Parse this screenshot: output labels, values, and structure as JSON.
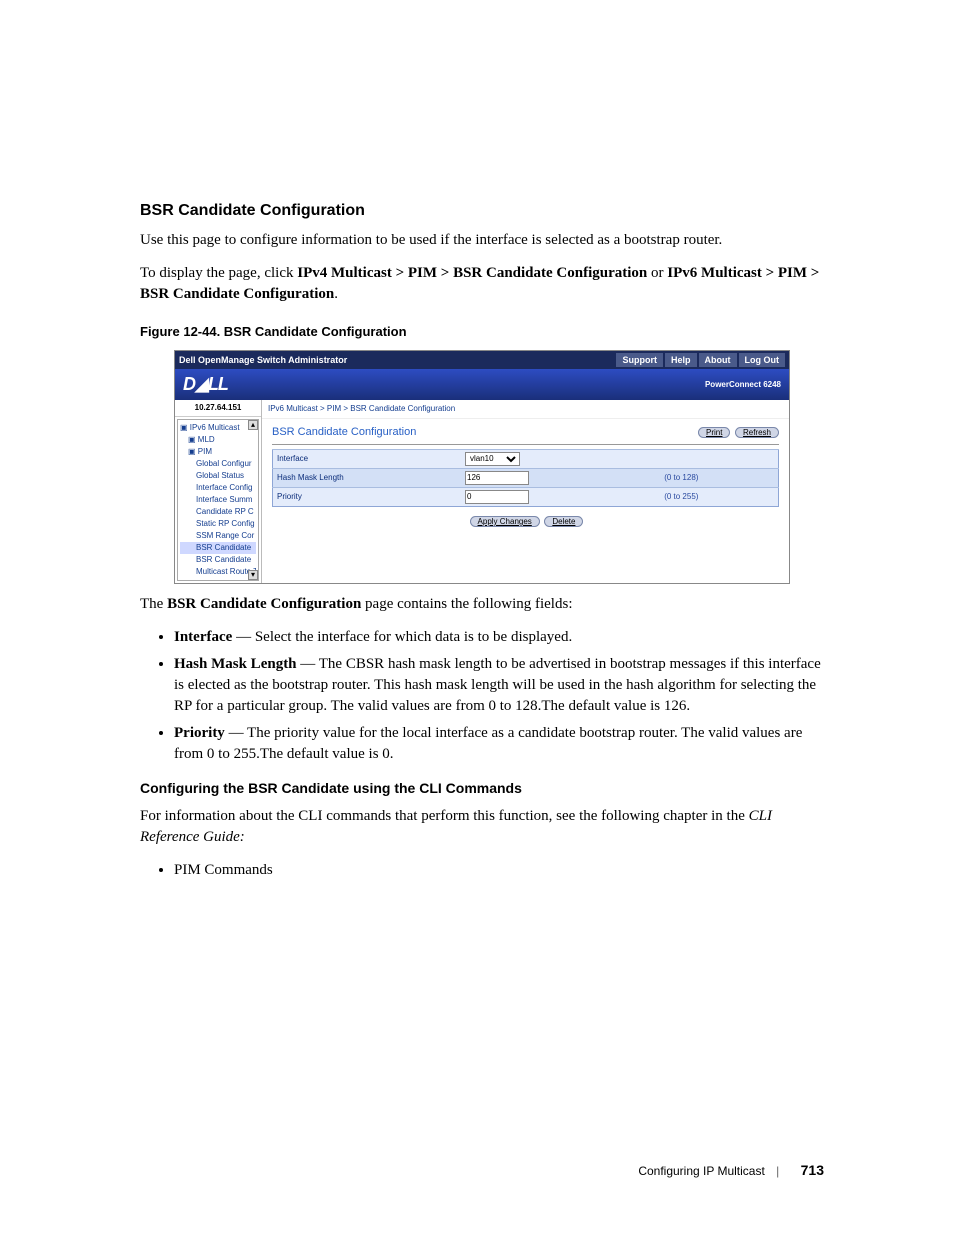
{
  "section_title": "BSR Candidate Configuration",
  "intro": "Use this page to configure information to be used if the interface is selected as a bootstrap router.",
  "nav_sentence_lead": "To display the page, click ",
  "nav_path_a": "IPv4 Multicast > PIM > BSR Candidate Configuration",
  "nav_or": " or ",
  "nav_path_b": "IPv6 Multicast > PIM > BSR Candidate Configuration",
  "nav_period": ".",
  "figure_caption": "Figure 12-44.    BSR Candidate Configuration",
  "screenshot": {
    "app_title": "Dell OpenManage Switch Administrator",
    "toplinks": [
      "Support",
      "Help",
      "About",
      "Log Out"
    ],
    "logo_text": "DELL",
    "model": "PowerConnect 6248",
    "ip": "10.27.64.151",
    "tree": {
      "root": "IPv6 Multicast",
      "mld": "MLD",
      "pim": "PIM",
      "items": [
        "Global Configur",
        "Global Status",
        "Interface Config",
        "Interface Summ",
        "Candidate RP C",
        "Static RP Config",
        "SSM Range Cor",
        "BSR Candidate",
        "BSR Candidate",
        "Multicast Route Ta"
      ],
      "selected_index": 7
    },
    "breadcrumb": "IPv6 Multicast > PIM > BSR Candidate Configuration",
    "panel_title": "BSR Candidate Configuration",
    "buttons": {
      "print": "Print",
      "refresh": "Refresh",
      "apply": "Apply Changes",
      "delete": "Delete"
    },
    "form": {
      "interface_label": "Interface",
      "interface_value": "vlan10",
      "hash_label": "Hash Mask Length",
      "hash_value": "126",
      "hash_hint": "(0 to 128)",
      "priority_label": "Priority",
      "priority_value": "0",
      "priority_hint": "(0 to 255)"
    }
  },
  "fields_intro_lead": "The ",
  "fields_intro_bold": "BSR Candidate Configuration",
  "fields_intro_tail": " page contains the following fields:",
  "bullets": [
    {
      "t": "Interface",
      "d": " — Select the interface for which data is to be displayed."
    },
    {
      "t": "Hash Mask Length",
      "d": " — The CBSR hash mask length to be advertised in bootstrap messages if this interface is elected as the bootstrap router. This hash mask length will be used in the hash algorithm for selecting the RP for a particular group. The valid values are from 0 to 128.The default value is 126."
    },
    {
      "t": "Priority",
      "d": " — The priority value for the local interface as a candidate bootstrap router. The valid values are from 0 to 255.The default value is 0."
    }
  ],
  "cli_heading": "Configuring the BSR Candidate using the CLI Commands",
  "cli_para_lead": "For information about the CLI commands that perform this function, see the following chapter in the ",
  "cli_para_italic": "CLI Reference Guide:",
  "cli_bullets": [
    "PIM Commands"
  ],
  "footer_title": "Configuring IP Multicast",
  "footer_page": "713"
}
